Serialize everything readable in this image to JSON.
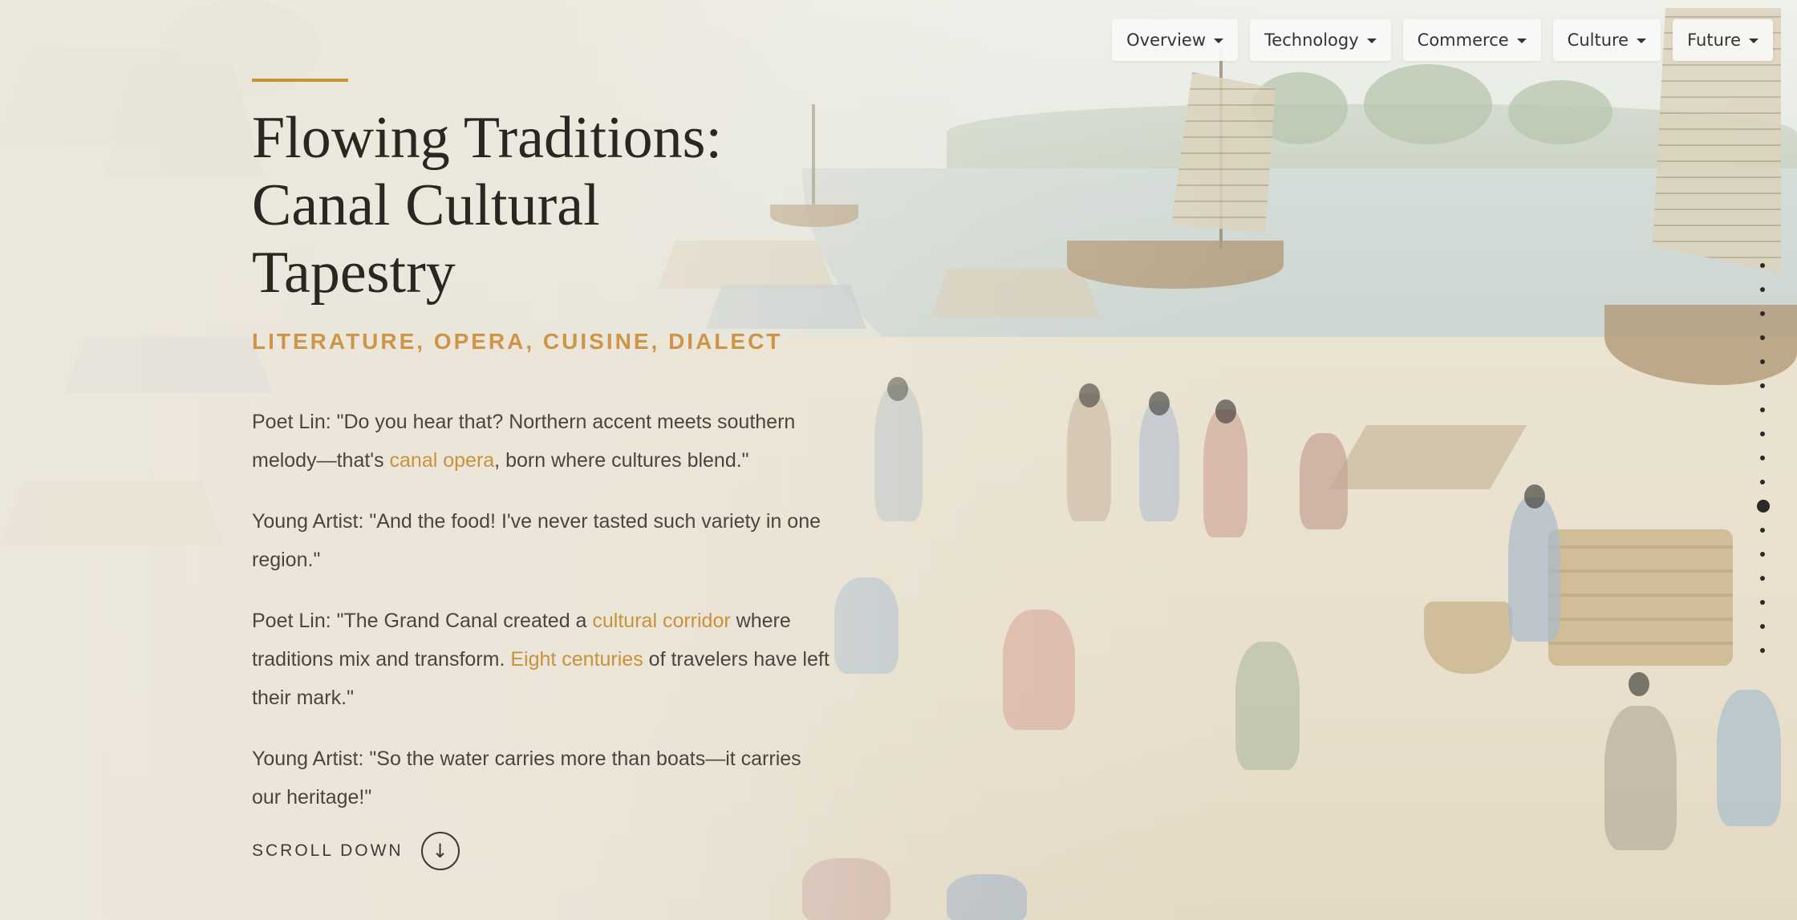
{
  "nav": {
    "items": [
      {
        "label": "Overview"
      },
      {
        "label": "Technology"
      },
      {
        "label": "Commerce"
      },
      {
        "label": "Culture"
      },
      {
        "label": "Future"
      }
    ]
  },
  "hero": {
    "title": "Flowing Traditions: Canal Cultural Tapestry",
    "subtitle": "LITERATURE, OPERA, CUISINE, DIALECT",
    "accent_color": "#c8913b",
    "dialogue": [
      {
        "parts": [
          "Poet Lin: \"Do you hear that? Northern accent meets southern melody—that's ",
          "canal opera",
          ", born where cultures blend.\""
        ]
      },
      {
        "parts": [
          "Young Artist: \"And the food! I've never tasted such variety in one region.\""
        ]
      },
      {
        "parts": [
          "Poet Lin: \"The Grand Canal created a ",
          "cultural corridor",
          " where traditions mix and transform. ",
          "Eight centuries",
          " of travelers have left their mark.\""
        ]
      },
      {
        "parts": [
          "Young Artist: \"So the water carries more than boats—it carries our heritage!\""
        ]
      }
    ],
    "scroll_label": "SCROLL DOWN",
    "scroll_icon": "arrow-down-icon"
  },
  "section_dots": {
    "count": 17,
    "active_index": 10
  }
}
